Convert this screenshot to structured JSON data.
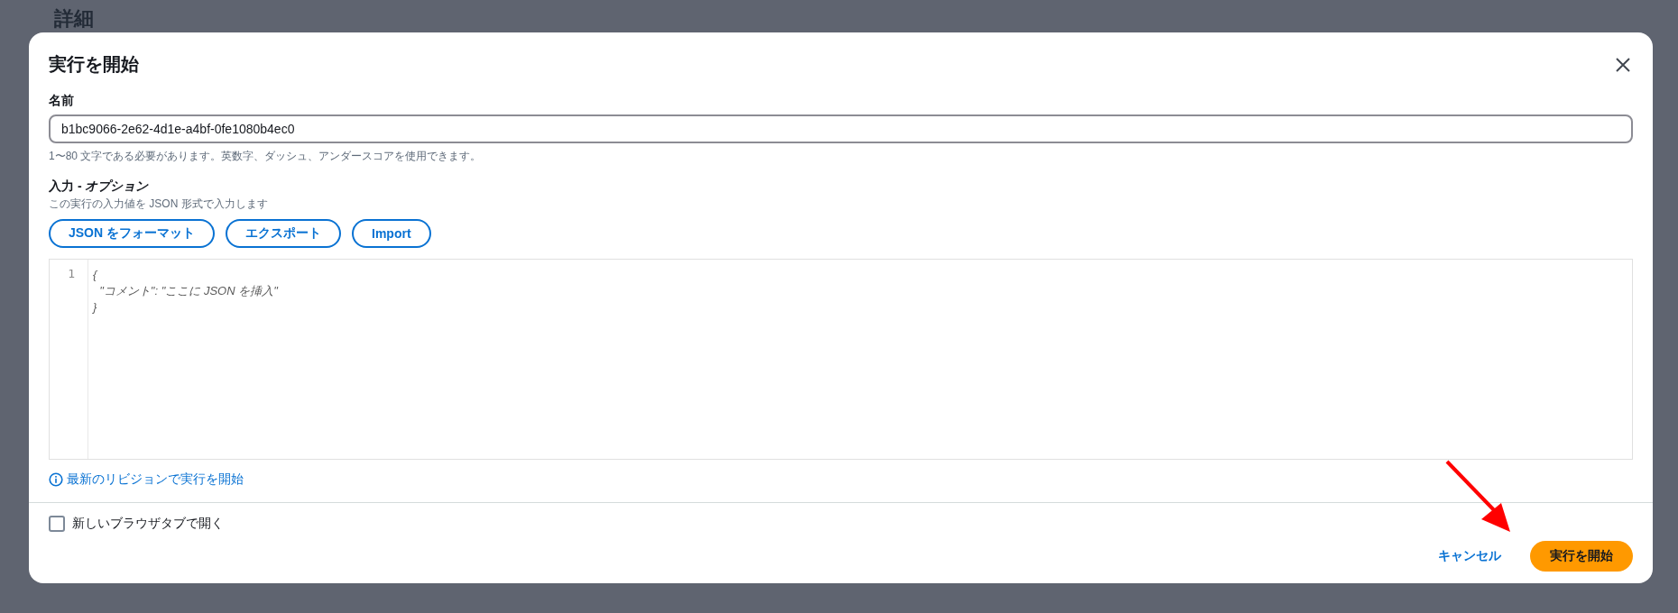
{
  "page": {
    "heading": "詳細"
  },
  "dialog": {
    "title": "実行を開始",
    "name_field": {
      "label": "名前",
      "value": "b1bc9066-2e62-4d1e-a4bf-0fe1080b4ec0",
      "hint": "1〜80 文字である必要があります。英数字、ダッシュ、アンダースコアを使用できます。"
    },
    "input_section": {
      "label": "入力 - *オプション*",
      "description": "この実行の入力値を JSON 形式で入力します",
      "buttons": [
        "JSON をフォーマット",
        "エクスポート",
        "Import"
      ],
      "editor": {
        "line_numbers": [
          "1"
        ],
        "lines": [
          "{",
          "  \"コメント\": \"ここに JSON を挿入\"",
          "}"
        ]
      }
    },
    "info_link": "最新のリビジョンで実行を開始",
    "new_tab_checkbox": {
      "label": "新しいブラウザタブで開く",
      "checked": false
    },
    "footer": {
      "cancel": "キャンセル",
      "submit": "実行を開始"
    }
  }
}
